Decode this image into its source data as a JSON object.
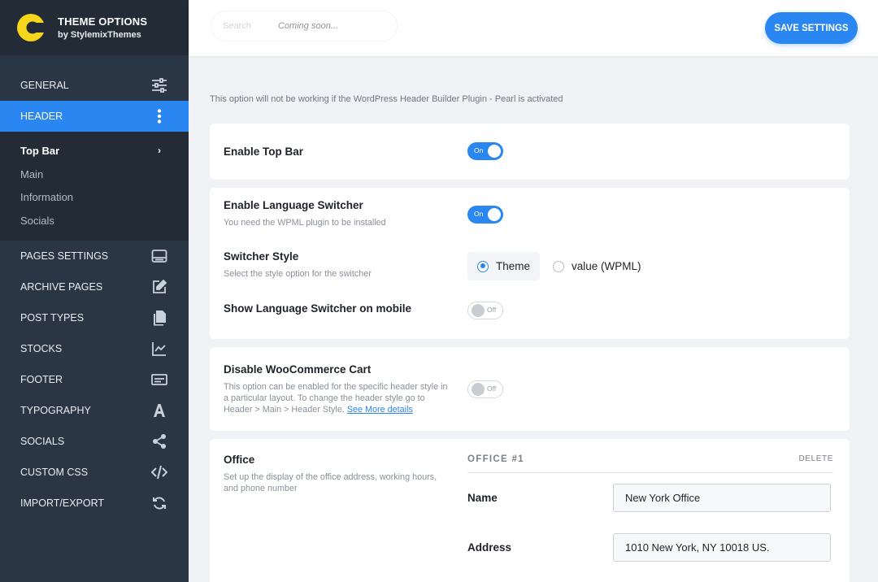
{
  "brand": {
    "title": "THEME OPTIONS",
    "subtitle": "by StylemixThemes",
    "logo_color": "#f5d61a"
  },
  "sidebar": {
    "items": [
      {
        "label": "GENERAL",
        "icon": "sliders-icon"
      },
      {
        "label": "HEADER",
        "icon": "more-vertical-icon",
        "active": true
      },
      {
        "label": "PAGES SETTINGS",
        "icon": "browser-window-icon"
      },
      {
        "label": "ARCHIVE PAGES",
        "icon": "edit-icon"
      },
      {
        "label": "POST TYPES",
        "icon": "copy-icon"
      },
      {
        "label": "STOCKS",
        "icon": "line-chart-icon"
      },
      {
        "label": "FOOTER",
        "icon": "footer-icon"
      },
      {
        "label": "TYPOGRAPHY",
        "icon": "typography-icon"
      },
      {
        "label": "SOCIALS",
        "icon": "share-icon"
      },
      {
        "label": "CUSTOM CSS",
        "icon": "code-icon"
      },
      {
        "label": "IMPORT/EXPORT",
        "icon": "sync-icon"
      }
    ],
    "subitems": [
      {
        "label": "Top Bar",
        "current": true
      },
      {
        "label": "Main"
      },
      {
        "label": "Information"
      },
      {
        "label": "Socials"
      }
    ]
  },
  "topbar": {
    "search_placeholder": "Search",
    "coming_soon": "Coming soon...",
    "save_label": "SAVE SETTINGS"
  },
  "notice": "This option will not be working if the WordPress Header Builder Plugin - Pearl is activated",
  "settings": {
    "top_bar": {
      "label": "Enable Top Bar",
      "toggle": "On"
    },
    "language_switcher": {
      "label": "Enable Language Switcher",
      "desc": "You need the WPML plugin to be installed",
      "toggle": "On"
    },
    "switcher_style": {
      "label": "Switcher Style",
      "desc": "Select the style option for the switcher",
      "options": [
        "Theme",
        "value (WPML)"
      ],
      "selected": "Theme"
    },
    "switcher_mobile": {
      "label": "Show Language Switcher on mobile",
      "toggle": "Off"
    },
    "woo_cart": {
      "label": "Disable WooCommerce Cart",
      "desc": "This option can be enabled for the specific header style in a particular layout. To change the header style go to Header > Main > Header Style.",
      "link": "See More details",
      "toggle": "Off"
    },
    "office": {
      "label": "Office",
      "desc": "Set up the display of the office address, working hours, and phone number",
      "entry_title": "OFFICE #1",
      "delete_label": "DELETE",
      "name_label": "Name",
      "name_value": "New York Office",
      "address_label": "Address",
      "address_value": "1010 New York, NY 10018 US."
    }
  },
  "colors": {
    "accent": "#2a86f0",
    "sidebar_bg": "#2b3644",
    "sidebar_dark": "#222b36"
  }
}
